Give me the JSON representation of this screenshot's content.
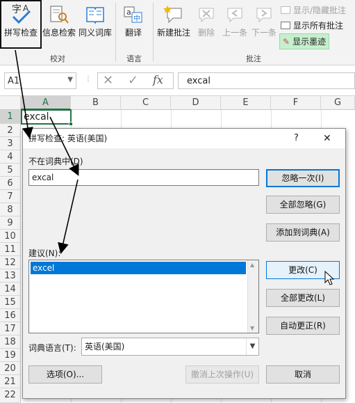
{
  "ribbon": {
    "spell_check": "拼写检查",
    "info_search": "信息检索",
    "thesaurus": "同义词库",
    "translate": "翻译",
    "new_comment": "新建批注",
    "delete": "删除",
    "prev": "上一条",
    "next": "下一条",
    "show_hide_comment": "显示/隐藏批注",
    "show_all_comments": "显示所有批注",
    "show_ink": "显示墨迹",
    "group_proofing": "校对",
    "group_language": "语言",
    "group_comments": "批注"
  },
  "formula_bar": {
    "name_box": "A1",
    "fx": "fx",
    "content": "excal"
  },
  "sheet": {
    "columns": [
      "A",
      "B",
      "C",
      "D",
      "E",
      "F",
      "G"
    ],
    "rows": [
      "1",
      "2",
      "3",
      "4",
      "5",
      "6",
      "7",
      "8",
      "9",
      "10",
      "11",
      "12",
      "13",
      "14",
      "15",
      "16",
      "17",
      "18",
      "19",
      "20",
      "21",
      "22"
    ],
    "cell_a1": "excal"
  },
  "dialog": {
    "title": "拼写检查: 英语(美国)",
    "help": "?",
    "close": "✕",
    "not_in_dict_label": "不在词典中(D)",
    "not_in_dict_value": "excal",
    "suggestions_label": "建议(N):",
    "suggestions": [
      "excel"
    ],
    "dict_lang_label": "词典语言(T):",
    "dict_lang_value": "英语(美国)",
    "buttons": {
      "ignore_once": "忽略一次(I)",
      "ignore_all": "全部忽略(G)",
      "add_to_dict": "添加到词典(A)",
      "change": "更改(C)",
      "change_all": "全部更改(L)",
      "autocorrect": "自动更正(R)",
      "options": "选项(O)...",
      "undo_last": "撤消上次操作(U)",
      "cancel": "取消"
    }
  },
  "colors": {
    "accent": "#0078d7",
    "selection": "#0078d7",
    "cell_border": "#217346",
    "ink_highlight": "#c6efce"
  }
}
